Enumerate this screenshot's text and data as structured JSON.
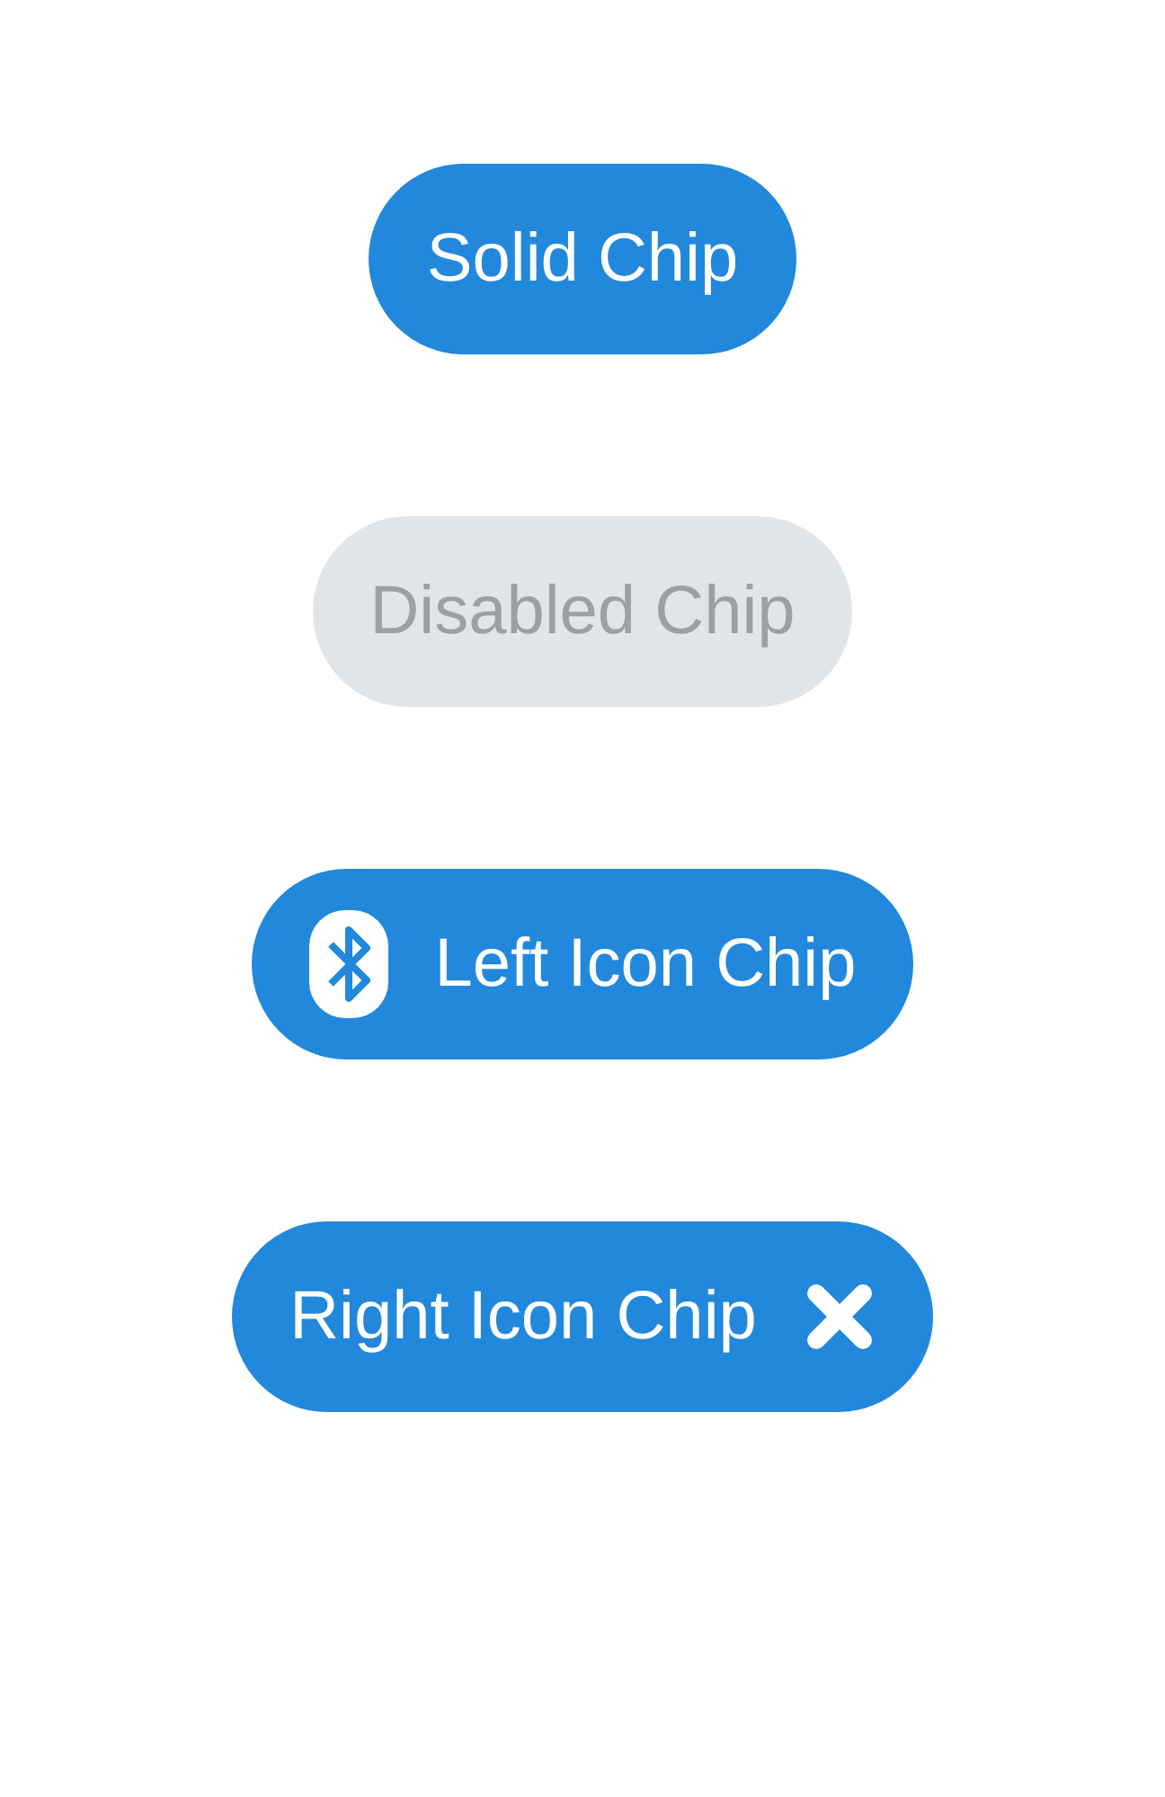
{
  "chips": [
    {
      "label": "Solid Chip",
      "kind": "plain",
      "disabled": false
    },
    {
      "label": "Disabled Chip",
      "kind": "plain",
      "disabled": true
    },
    {
      "label": "Left Icon Chip",
      "kind": "left_icon",
      "disabled": false
    },
    {
      "label": "Right Icon Chip",
      "kind": "right_icon",
      "disabled": false
    }
  ]
}
